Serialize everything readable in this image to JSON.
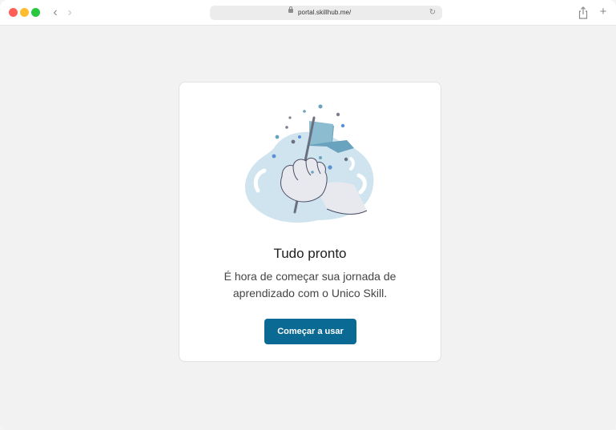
{
  "browser": {
    "url": "portal.skillhub.me/",
    "icons": {
      "back": "chevron-left-icon",
      "forward": "chevron-right-icon",
      "lock": "lock-icon",
      "reload": "reload-icon",
      "share": "share-icon",
      "new_tab": "plus-icon"
    }
  },
  "card": {
    "title": "Tudo pronto",
    "description": "É hora de começar sua jornada de aprendizado com o Unico Skill.",
    "button_label": "Começar a usar"
  },
  "colors": {
    "accent": "#0b6a93",
    "illustration_bg": "#cfe4ee",
    "flag": "#6aa3bd"
  }
}
